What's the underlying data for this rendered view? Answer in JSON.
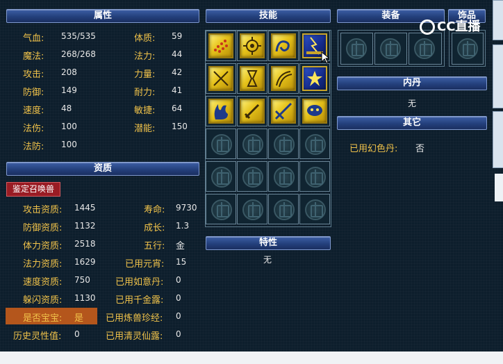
{
  "attributes": {
    "header": "属性",
    "rows_left": [
      {
        "label": "气血:",
        "value": "535/535"
      },
      {
        "label": "魔法:",
        "value": "268/268"
      },
      {
        "label": "攻击:",
        "value": "208"
      },
      {
        "label": "防御:",
        "value": "149"
      },
      {
        "label": "速度:",
        "value": "48"
      },
      {
        "label": "法伤:",
        "value": "100"
      },
      {
        "label": "法防:",
        "value": "100"
      }
    ],
    "rows_right": [
      {
        "label": "体质:",
        "value": "59"
      },
      {
        "label": "法力:",
        "value": "44"
      },
      {
        "label": "力量:",
        "value": "42"
      },
      {
        "label": "耐力:",
        "value": "41"
      },
      {
        "label": "敏捷:",
        "value": "64"
      },
      {
        "label": "潜能:",
        "value": "150"
      }
    ]
  },
  "aptitude": {
    "header": "资质",
    "appraise_button": "鉴定召唤兽",
    "rows_left": [
      {
        "label": "攻击资质:",
        "value": "1445"
      },
      {
        "label": "防御资质:",
        "value": "1132"
      },
      {
        "label": "体力资质:",
        "value": "2518"
      },
      {
        "label": "法力资质:",
        "value": "1629"
      },
      {
        "label": "速度资质:",
        "value": "750"
      },
      {
        "label": "躲闪资质:",
        "value": "1130"
      },
      {
        "label": "是否宝宝:",
        "value": "是"
      },
      {
        "label": "历史灵性值:",
        "value": "0"
      }
    ],
    "rows_right": [
      {
        "label": "寿命:",
        "value": "9730"
      },
      {
        "label": "成长:",
        "value": "1.3"
      },
      {
        "label": "五行:",
        "value": "金"
      },
      {
        "label": "已用元宵:",
        "value": "15"
      },
      {
        "label": "已用如意丹:",
        "value": "0"
      },
      {
        "label": "已用千金露:",
        "value": "0"
      },
      {
        "label": "已用炼兽珍经:",
        "value": "0"
      },
      {
        "label": "已用清灵仙露:",
        "value": "0"
      }
    ]
  },
  "skills": {
    "header": "技能",
    "icons": [
      "skill-icon-1",
      "skill-icon-2",
      "skill-icon-3",
      "skill-icon-4",
      "skill-icon-5",
      "skill-icon-6",
      "skill-icon-7",
      "skill-icon-8",
      "skill-icon-9",
      "skill-icon-10",
      "skill-icon-11",
      "skill-icon-12"
    ],
    "empty_slots": 12
  },
  "traits": {
    "header": "特性",
    "value": "无"
  },
  "equipment": {
    "header": "装备",
    "slots": 3
  },
  "accessory": {
    "header": "饰品",
    "slots": 1
  },
  "inner_pill": {
    "header": "内丹",
    "value": "无"
  },
  "other": {
    "header": "其它",
    "label": "已用幻色丹:",
    "value": "否"
  },
  "watermark": {
    "text": "CC直播"
  },
  "colors": {
    "label": "#f0c24a",
    "header": "#24407c",
    "skill_gold": "#e6c21a",
    "highlight": "#b4561c"
  }
}
